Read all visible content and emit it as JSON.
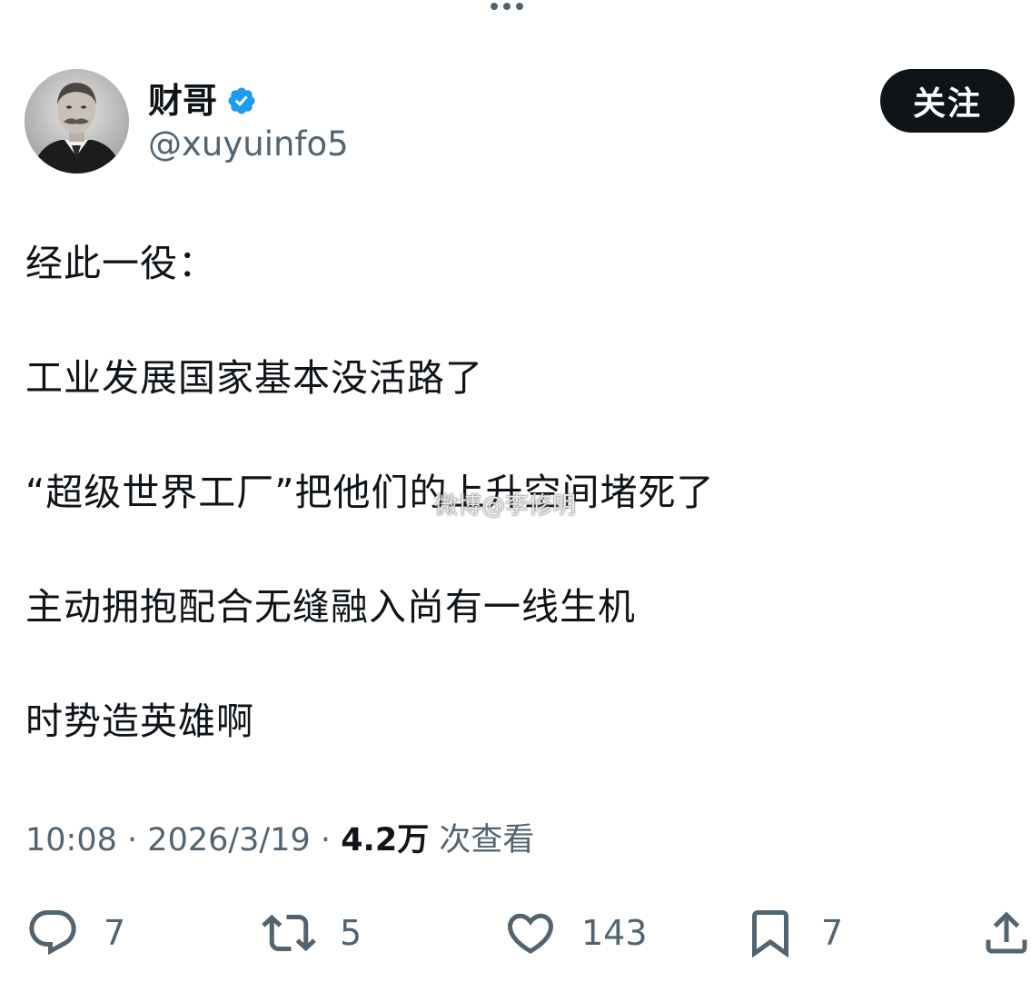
{
  "profile": {
    "display_name": "财哥",
    "handle": "@xuyuinfo5",
    "verified": true,
    "follow_label": "关注"
  },
  "tweet": {
    "lines": [
      "经此一役：",
      "工业发展国家基本没活路了",
      "“超级世界工厂”把他们的上升空间堵死了",
      "主动拥抱配合无缝融入尚有一线生机",
      "时势造英雄啊"
    ],
    "watermark": "微博@李修明"
  },
  "meta": {
    "time": "10:08",
    "separator": "·",
    "date": "2026/3/19",
    "views": "4.2万",
    "views_label": "次查看"
  },
  "actions": {
    "reply_count": "7",
    "retweet_count": "5",
    "like_count": "143",
    "bookmark_count": "7"
  },
  "icons": {
    "reply": "speech-bubble-icon",
    "retweet": "retweet-arrows-icon",
    "like": "heart-icon",
    "bookmark": "bookmark-icon",
    "share": "share-upload-icon",
    "verified": "verified-badge-icon"
  },
  "colors": {
    "text_primary": "#0f1419",
    "text_secondary": "#536471",
    "verified_blue": "#1d9bf0",
    "button_bg": "#0f1419",
    "button_text": "#ffffff"
  }
}
